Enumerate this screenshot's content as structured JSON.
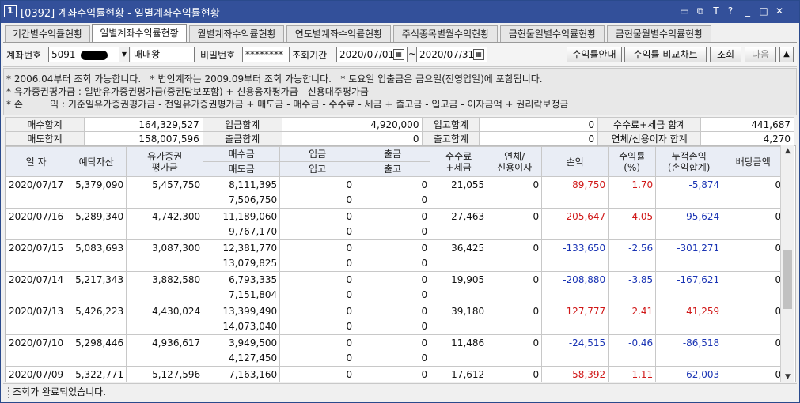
{
  "window": {
    "number": "1",
    "title": "[0392] 계좌수익률현황 - 일별계좌수익률현황",
    "controls": [
      "▭",
      "⧉",
      "T",
      "?",
      "_",
      "□",
      "✕"
    ]
  },
  "tabs": [
    {
      "label": "기간별수익률현황",
      "active": false
    },
    {
      "label": "일별계좌수익률현황",
      "active": true
    },
    {
      "label": "월별계좌수익률현황",
      "active": false
    },
    {
      "label": "연도별계좌수익률현황",
      "active": false
    },
    {
      "label": "주식종목별월수익현황",
      "active": false
    },
    {
      "label": "금현물일별수익률현황",
      "active": false
    },
    {
      "label": "금현물월별수익률현황",
      "active": false
    }
  ],
  "controls": {
    "account_label": "계좌번호",
    "account_value": "5091-",
    "account_name": "매매왕",
    "password_label": "비밀번호",
    "password_value": "********",
    "period_label": "조회기간",
    "date_from": "2020/07/01",
    "tilde": "~",
    "date_to": "2020/07/31",
    "btn_guide": "수익률안내",
    "btn_compare": "수익률 비교차트",
    "btn_search": "조회",
    "btn_next": "다음",
    "btn_collapse": "▲"
  },
  "notes": [
    "* 2006.04부터 조회 가능합니다.   * 법인계좌는 2009.09부터 조회 가능합니다.   * 토요일 입출금은 금요일(전영업일)에 포함됩니다.",
    "* 유가증권평가금 : 일반유가증권평가금(증권담보포함) + 신용융자평가금 - 신용대주평가금",
    "* 손         익 : 기준일유가증권평가금 - 전일유가증권평가금 + 매도금 - 매수금 - 수수료 - 세금 + 출고금 - 입고금 - 이자금액 + 권리락보정금"
  ],
  "summary": {
    "row1": [
      {
        "label": "매수합계",
        "value": "164,329,527"
      },
      {
        "label": "입금합계",
        "value": "4,920,000"
      },
      {
        "label": "입고합계",
        "value": "0"
      },
      {
        "label": "수수료+세금 합계",
        "value": "441,687"
      }
    ],
    "row2": [
      {
        "label": "매도합계",
        "value": "158,007,596"
      },
      {
        "label": "출금합계",
        "value": "0"
      },
      {
        "label": "출고합계",
        "value": "0"
      },
      {
        "label": "연체/신용이자 합계",
        "value": "4,270"
      }
    ]
  },
  "grid": {
    "headers": {
      "date": "일 자",
      "deposit_assets": "예탁자산",
      "securities_eval": "유가증권\n평가금",
      "buy": "매수금",
      "sell": "매도금",
      "deposit_in": "입금",
      "stock_in": "입고",
      "withdraw": "출금",
      "stock_out": "출고",
      "fee_tax": "수수료\n+세금",
      "overdue_interest": "연체/\n신용이자",
      "pnl": "손익",
      "return_rate": "수익률\n(%)",
      "cum_pnl": "누적손익\n(손익합계)",
      "dividend": "배당금액"
    },
    "rows": [
      {
        "date": "2020/07/17",
        "assets": "5,379,090",
        "eval": "5,457,750",
        "buy": "8,111,395",
        "sell": "7,506,750",
        "dep": "0",
        "sin": "0",
        "wd": "0",
        "sout": "0",
        "fee": "21,055",
        "interest": "0",
        "pnl": "89,750",
        "rate": "1.70",
        "cum": "-5,874",
        "div": "0",
        "pnl_color": "red",
        "cum_color": "blue"
      },
      {
        "date": "2020/07/16",
        "assets": "5,289,340",
        "eval": "4,742,300",
        "buy": "11,189,060",
        "sell": "9,767,170",
        "dep": "0",
        "sin": "0",
        "wd": "0",
        "sout": "0",
        "fee": "27,463",
        "interest": "0",
        "pnl": "205,647",
        "rate": "4.05",
        "cum": "-95,624",
        "div": "0",
        "pnl_color": "red",
        "cum_color": "blue"
      },
      {
        "date": "2020/07/15",
        "assets": "5,083,693",
        "eval": "3,087,300",
        "buy": "12,381,770",
        "sell": "13,079,825",
        "dep": "0",
        "sin": "0",
        "wd": "0",
        "sout": "0",
        "fee": "36,425",
        "interest": "0",
        "pnl": "-133,650",
        "rate": "-2.56",
        "cum": "-301,271",
        "div": "0",
        "pnl_color": "blue",
        "cum_color": "blue"
      },
      {
        "date": "2020/07/14",
        "assets": "5,217,343",
        "eval": "3,882,580",
        "buy": "6,793,335",
        "sell": "7,151,804",
        "dep": "0",
        "sin": "0",
        "wd": "0",
        "sout": "0",
        "fee": "19,905",
        "interest": "0",
        "pnl": "-208,880",
        "rate": "-3.85",
        "cum": "-167,621",
        "div": "0",
        "pnl_color": "blue",
        "cum_color": "blue"
      },
      {
        "date": "2020/07/13",
        "assets": "5,426,223",
        "eval": "4,430,024",
        "buy": "13,399,490",
        "sell": "14,073,040",
        "dep": "0",
        "sin": "0",
        "wd": "0",
        "sout": "0",
        "fee": "39,180",
        "interest": "0",
        "pnl": "127,777",
        "rate": "2.41",
        "cum": "41,259",
        "div": "0",
        "pnl_color": "red",
        "cum_color": "red"
      },
      {
        "date": "2020/07/10",
        "assets": "5,298,446",
        "eval": "4,936,617",
        "buy": "3,949,500",
        "sell": "4,127,450",
        "dep": "0",
        "sin": "0",
        "wd": "0",
        "sout": "0",
        "fee": "11,486",
        "interest": "0",
        "pnl": "-24,515",
        "rate": "-0.46",
        "cum": "-86,518",
        "div": "0",
        "pnl_color": "blue",
        "cum_color": "blue"
      },
      {
        "date": "2020/07/09",
        "assets": "5,322,771",
        "eval": "5,127,596",
        "buy": "7,163,160",
        "sell": "",
        "dep": "0",
        "sin": "",
        "wd": "0",
        "sout": "",
        "fee": "17,612",
        "interest": "0",
        "pnl": "58,392",
        "rate": "1.11",
        "cum": "-62,003",
        "div": "0",
        "pnl_color": "red",
        "cum_color": "blue"
      }
    ]
  },
  "status": {
    "message": "조회가 완료되었습니다."
  },
  "colors": {
    "title_bar": "#33509a",
    "header_bg": "#e9edf5",
    "positive": "#d01818",
    "negative": "#1a34b4"
  }
}
